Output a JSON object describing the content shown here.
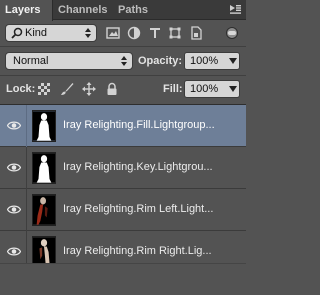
{
  "tabs": [
    {
      "label": "Layers",
      "active": true
    },
    {
      "label": "Channels",
      "active": false
    },
    {
      "label": "Paths",
      "active": false
    }
  ],
  "filter": {
    "kind_label": "Kind",
    "icons": [
      "pixel-filter-icon",
      "adjustment-filter-icon",
      "type-filter-icon",
      "shape-filter-icon",
      "smart-object-filter-icon"
    ],
    "toggle_on": true
  },
  "blend": {
    "mode": "Normal",
    "opacity_label": "Opacity:",
    "opacity_value": "100%"
  },
  "lock": {
    "label": "Lock:",
    "icons": [
      "lock-transparent-pixels-icon",
      "lock-image-pixels-icon",
      "lock-position-icon",
      "lock-all-icon"
    ],
    "fill_label": "Fill:",
    "fill_value": "100%"
  },
  "layers": [
    {
      "name": "Iray Relighting.Fill.Lightgroup...",
      "visible": true,
      "selected": true,
      "thumb": "white-silhouette"
    },
    {
      "name": "Iray Relighting.Key.Lightgrou...",
      "visible": true,
      "selected": false,
      "thumb": "white-silhouette"
    },
    {
      "name": "Iray Relighting.Rim Left.Light...",
      "visible": true,
      "selected": false,
      "thumb": "dark-rim-left"
    },
    {
      "name": "Iray Relighting.Rim Right.Lig...",
      "visible": true,
      "selected": false,
      "thumb": "dark-rim-right"
    }
  ],
  "colors": {
    "panel_bg": "#535353",
    "selected_row": "#6e7f98",
    "field_bg": "#d6d6d6"
  }
}
